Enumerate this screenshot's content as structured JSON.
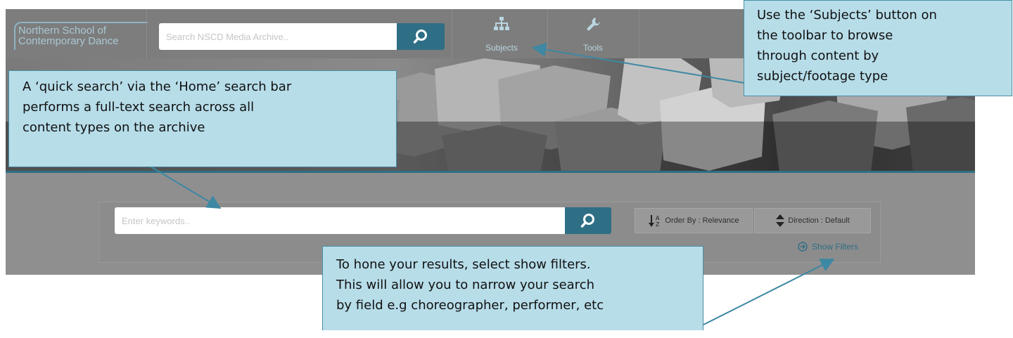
{
  "logo": {
    "line1": "Northern School of",
    "line2": "Contemporary Dance"
  },
  "top_search": {
    "placeholder": "Search NSCD Media Archive.."
  },
  "toolbar": {
    "subjects_label": "Subjects",
    "tools_label": "Tools",
    "icons": {
      "subjects": "hierarchy-icon",
      "tools": "wrench-icon",
      "search": "search-icon"
    }
  },
  "search": {
    "placeholder": "Enter keywords..",
    "order_label": "Order By : Relevance",
    "direction_label": "Direction : Default",
    "show_filters_label": "Show Filters"
  },
  "callouts": {
    "subjects": {
      "lines": [
        "Use the ‘Subjects’ button on",
        "the toolbar to browse",
        "through content by",
        "subject/footage type"
      ]
    },
    "quick_search": {
      "lines": [
        "A ‘quick search’ via the ‘Home’ search bar",
        "performs a full-text search across all",
        "content types on the archive"
      ]
    },
    "filters": {
      "lines": [
        "To hone your results, select show filters.",
        "This will allow you to narrow your search",
        "by field e.g choreographer, performer, etc"
      ]
    }
  },
  "colors": {
    "accent": "#2e6f85",
    "callout_fill": "#b7dde9",
    "callout_border": "#4a8fa5",
    "toolbar_bg": "#7d7d7d",
    "section_bg": "#8f8f8f"
  }
}
